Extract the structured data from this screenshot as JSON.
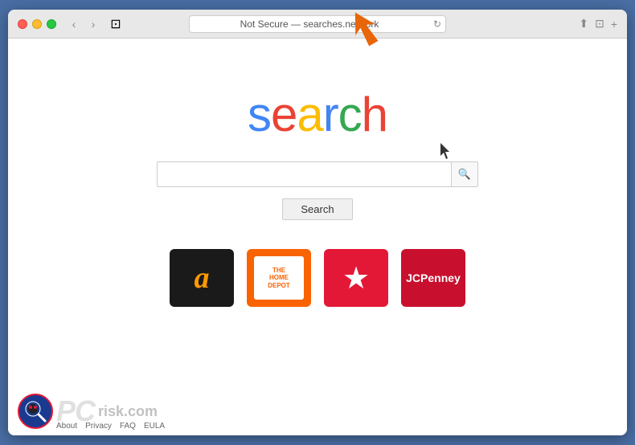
{
  "browser": {
    "title": "Not Secure — searches.network",
    "url": "Not Secure — searches.network",
    "traffic_lights": [
      "red",
      "yellow",
      "green"
    ]
  },
  "page": {
    "logo": {
      "letters": [
        "s",
        "e",
        "a",
        "r",
        "c",
        "h"
      ],
      "colors": [
        "#4285f4",
        "#ea4335",
        "#fbbc05",
        "#4285f4",
        "#34a853",
        "#ea4335"
      ]
    },
    "search_placeholder": "",
    "search_button_label": "Search",
    "bookmarks": [
      {
        "name": "Amazon",
        "bg": "#1a1a1a",
        "type": "amazon"
      },
      {
        "name": "The Home Depot",
        "bg": "#f96302",
        "type": "homedepot"
      },
      {
        "name": "Macy's",
        "bg": "#e31837",
        "type": "macys"
      },
      {
        "name": "JCPenney",
        "bg": "#c8102e",
        "type": "jcpenney"
      }
    ]
  },
  "footer": {
    "links": [
      "About",
      "Privacy",
      "FAQ",
      "EULA"
    ],
    "watermark": "pcrisk.com"
  },
  "icons": {
    "search": "🔍",
    "back": "‹",
    "forward": "›",
    "reload": "↻",
    "share": "⬆",
    "newTab": "⊡",
    "add": "+"
  }
}
